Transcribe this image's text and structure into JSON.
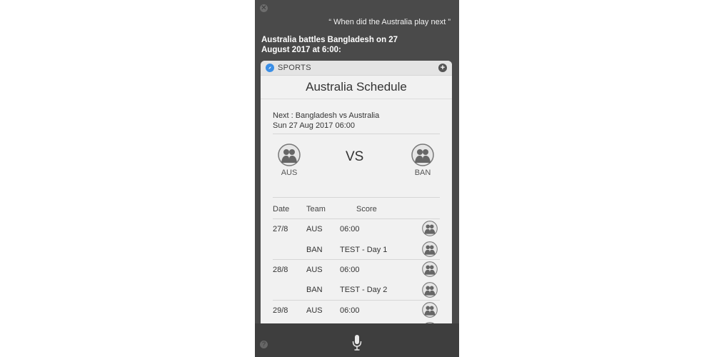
{
  "siri": {
    "query": "“ When did the Australia play next ”",
    "answer": "Australia battles Bangladesh on 27 August 2017 at 6:00:"
  },
  "card": {
    "category": "SPORTS",
    "title": "Australia Schedule",
    "next_line1": "Next : Bangladesh vs Australia",
    "next_line2": "Sun 27 Aug 2017 06:00",
    "home_team": "AUS",
    "away_team": "BAN",
    "vs": "VS",
    "table": {
      "headers": [
        "Date",
        "Team",
        "Score"
      ],
      "rows": [
        {
          "date": "27/8",
          "team": "AUS",
          "score": "06:00"
        },
        {
          "date": "",
          "team": "BAN",
          "score": "TEST - Day 1"
        },
        {
          "date": "28/8",
          "team": "AUS",
          "score": "06:00"
        },
        {
          "date": "",
          "team": "BAN",
          "score": "TEST - Day 2"
        },
        {
          "date": "29/8",
          "team": "AUS",
          "score": "06:00"
        }
      ]
    }
  },
  "icons": {
    "close": "close-icon",
    "sports": "compass-icon",
    "add": "plus-icon",
    "team": "people-icon",
    "mic": "microphone-icon",
    "help": "help-icon"
  },
  "colors": {
    "panel": "#4a4a4a",
    "card": "#f1f1f1",
    "accent": "#3a8ee6"
  }
}
